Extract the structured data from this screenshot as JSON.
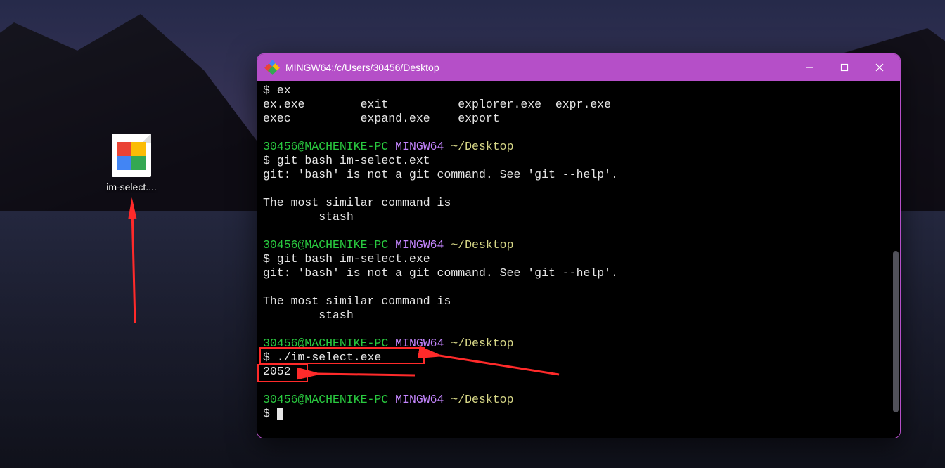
{
  "desktop": {
    "icon_label": "im-select...."
  },
  "window": {
    "title": "MINGW64:/c/Users/30456/Desktop"
  },
  "term": {
    "l1": "$ ex",
    "l2": "ex.exe        exit          explorer.exe  expr.exe",
    "l3": "exec          expand.exe    export",
    "blank": "",
    "p_user": "30456@MACHENIKE-PC",
    "p_env": " MINGW64",
    "p_path": " ~/Desktop",
    "cmd_git_ext": "$ git bash im-select.ext",
    "git_err": "git: 'bash' is not a git command. See 'git --help'.",
    "similar1": "The most similar command is",
    "similar2": "        stash",
    "cmd_git_exe": "$ git bash im-select.exe",
    "cmd_run_dollar": "$",
    "cmd_run_rest": " ./im-select.exe",
    "out_2052": "2052",
    "prompt_dollar": "$ "
  }
}
